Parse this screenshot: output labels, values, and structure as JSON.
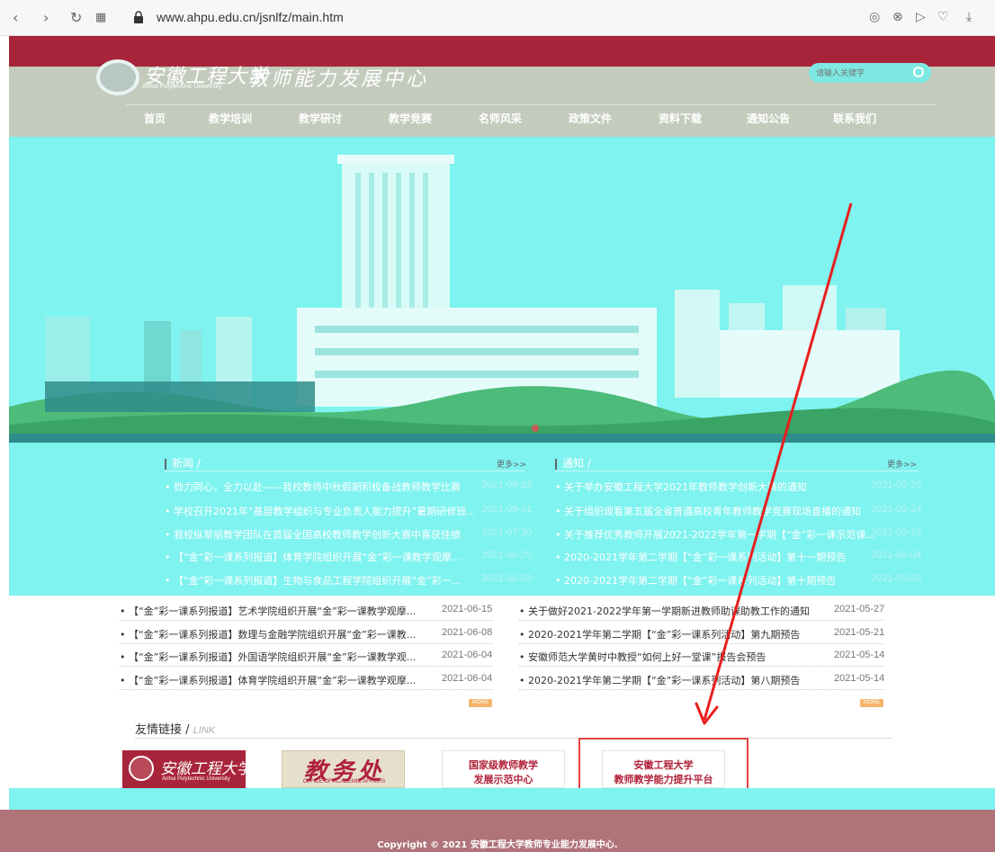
{
  "browser": {
    "url": "www.ahpu.edu.cn/jsnlfz/main.htm",
    "back_icon": "chevron-left-icon",
    "forward_icon": "chevron-right-icon",
    "reload_icon": "reload-icon",
    "apps_icon": "grid-icon",
    "tool_icons": [
      "camera-icon",
      "close-circle-icon",
      "play-icon",
      "heart-icon",
      "download-icon"
    ]
  },
  "header": {
    "logo_cn": "安徽工程大学",
    "logo_en": "Anhui Polytechnic University",
    "site_title": "教师能力发展中心",
    "search_placeholder": "请输入关键字"
  },
  "nav": {
    "items": [
      "首页",
      "教学培训",
      "教学研讨",
      "教学竞赛",
      "名师风采",
      "政策文件",
      "资料下载",
      "通知公告",
      "联系我们"
    ]
  },
  "news": {
    "title": "新闻",
    "more": "更多>>",
    "items": [
      {
        "title": "勠力同心，全力以赴——我校教师中秋假期积极备战教师教学比赛",
        "date": "2021-09-22"
      },
      {
        "title": "学校召开2021年“基层教学组织与专业负责人能力提升”暑期研修班...",
        "date": "2021-09-01"
      },
      {
        "title": "我校纵翠丽教学团队在首届全国高校教师教学创新大赛中喜获佳绩",
        "date": "2021-07-30"
      },
      {
        "title": "【“金”彩一课系列报道】体育学院组织开展“金”彩一课教学观摩...",
        "date": "2021-06-25"
      },
      {
        "title": "【“金”彩一课系列报道】生物与食品工程学院组织开展“金”彩一...",
        "date": "2021-06-25"
      },
      {
        "title": "【“金”彩一课系列报道】艺术学院组织开展“金”彩一课教学观摩...",
        "date": "2021-06-15"
      },
      {
        "title": "【“金”彩一课系列报道】数理与金融学院组织开展“金”彩一课教...",
        "date": "2021-06-08"
      },
      {
        "title": "【“金”彩一课系列报道】外国语学院组织开展“金”彩一课教学观...",
        "date": "2021-06-04"
      },
      {
        "title": "【“金”彩一课系列报道】体育学院组织开展“金”彩一课教学观摩...",
        "date": "2021-06-04"
      }
    ],
    "more_badge": "MORE"
  },
  "notices": {
    "title": "通知",
    "more": "更多>>",
    "items": [
      {
        "title": "关于举办安徽工程大学2021年教师教学创新大赛的通知",
        "date": "2021-09-26"
      },
      {
        "title": "关于组织观看第五届全省普通高校青年教师教学竞赛现场直播的通知",
        "date": "2021-09-24"
      },
      {
        "title": "关于推荐优秀教师开展2021-2022学年第一学期【“金”彩一课示范课...",
        "date": "2021-09-16"
      },
      {
        "title": "2020-2021学年第二学期【“金”彩一课系列活动】第十一期预告",
        "date": "2021-06-04"
      },
      {
        "title": "2020-2021学年第二学期【“金”彩一课系列活动】第十期预告",
        "date": "2021-05-28"
      },
      {
        "title": "关于做好2021-2022学年第一学期新进教师助课助教工作的通知",
        "date": "2021-05-27"
      },
      {
        "title": "2020-2021学年第二学期【“金”彩一课系列活动】第九期预告",
        "date": "2021-05-21"
      },
      {
        "title": "安徽师范大学黄时中教授“如何上好一堂课”报告会预告",
        "date": "2021-05-14"
      },
      {
        "title": "2020-2021学年第二学期【“金”彩一课系列活动】第八期预告",
        "date": "2021-05-14"
      }
    ],
    "more_badge": "MORE"
  },
  "links": {
    "title": "友情链接",
    "title_en": "LINK",
    "items": [
      {
        "name": "安徽工程大学",
        "sub": "Anhui Polytechnic University"
      },
      {
        "name": "教务处",
        "sub": "OFFICE OF ACADEMIC AFFAIRS"
      },
      {
        "line1": "国家级教师教学",
        "line2": "发展示范中心"
      },
      {
        "line1": "安徽工程大学",
        "line2": "教师教学能力提升平台"
      }
    ]
  },
  "footer": {
    "copyright": "Copyright © 2021 安徽工程大学教师专业能力发展中心."
  },
  "colors": {
    "brand_red": "#a8243a",
    "highlight": "#e84040",
    "footer": "#b0737a"
  }
}
